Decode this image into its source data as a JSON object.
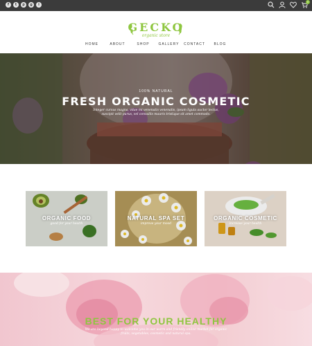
{
  "social": {
    "icons": [
      "facebook-icon",
      "twitter-icon",
      "pinterest-icon",
      "google-plus-icon",
      "instagram-icon"
    ],
    "glyphs": [
      "f",
      "t",
      "p",
      "g",
      "i"
    ]
  },
  "tools": {
    "cart_count": "0"
  },
  "logo": {
    "title": "GECKO",
    "subtitle": "organic store"
  },
  "nav": {
    "items": [
      "HOME",
      "ABOUT",
      "SHOP",
      "GALLERY",
      "CONTACT",
      "BLOG"
    ]
  },
  "hero": {
    "tag": "100% NATURAL",
    "title": "FRESH ORGANIC COSMETIC",
    "description": "Integer cursus magna, vitae mi venenatis venenatis, ipsum ligula auctor lectus, suscipit velit purus, vel convallis mauris tristique sit amet commodo."
  },
  "cards": [
    {
      "title": "ORGANIC FOOD",
      "subtitle": "good for your health"
    },
    {
      "title": "NATURAL SPA SET",
      "subtitle": "improve your mood"
    },
    {
      "title": "ORGANIC COSMETIC",
      "subtitle": "increase your health"
    }
  ],
  "bottom": {
    "title": "BEST FOR YOUR HEALTHY",
    "description": "We are beyond happy to welcome you in our warm and friendly online market for organic fruits, vegetables, cosmetic and natural spa."
  },
  "colors": {
    "accent": "#8ec63f",
    "topbar": "#3b3b3b"
  }
}
